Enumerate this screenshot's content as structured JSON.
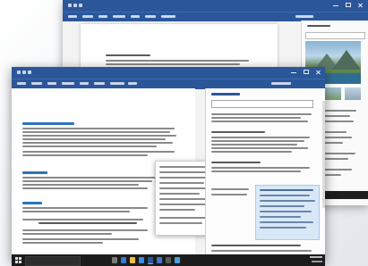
{
  "colors": {
    "word_blue": "#2b579a",
    "heading_blue": "#2e74b5",
    "taskbar": "#1c1c1c"
  },
  "back_window": {
    "app": "word",
    "window_controls": [
      "minimize-icon",
      "maximize-icon",
      "close-icon"
    ],
    "pane_has_image_results": true
  },
  "front_window": {
    "app": "word",
    "window_controls": [
      "minimize-icon",
      "maximize-icon",
      "close-icon"
    ],
    "pane_has_search_box": true
  },
  "taskbar": {
    "icons": [
      "start-icon",
      "search-icon",
      "task-view-icon",
      "edge-icon",
      "explorer-icon",
      "store-icon",
      "word-icon",
      "mail-icon"
    ]
  }
}
